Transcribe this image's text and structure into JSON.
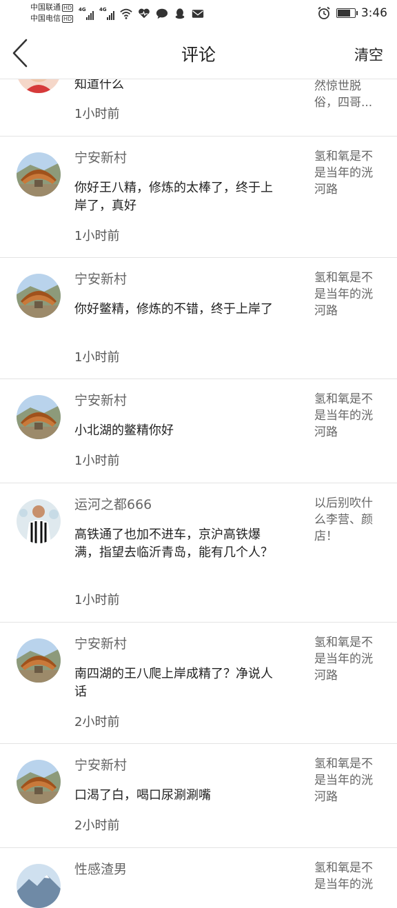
{
  "status_bar": {
    "carrier1": "中国联通",
    "carrier2": "中国电信",
    "hd": "HD",
    "net1": "4G",
    "net2": "4G",
    "time": "3:46"
  },
  "header": {
    "title": "评论",
    "clear_label": "清空"
  },
  "partial_item": {
    "content": "知道什么",
    "time": "1小时前",
    "quote": "然惊世脱俗，四哥..."
  },
  "comments": [
    {
      "name": "宁安新村",
      "content": "你好王八精，修炼的太棒了，终于上岸了，真好",
      "time": "1小时前",
      "quote": "氢和氧是不是当年的洸河路"
    },
    {
      "name": "宁安新村",
      "content": "你好鳖精，修炼的不错，终于上岸了",
      "time": "1小时前",
      "quote": "氢和氧是不是当年的洸河路"
    },
    {
      "name": "宁安新村",
      "content": "小北湖的鳖精你好",
      "time": "1小时前",
      "quote": "氢和氧是不是当年的洸河路"
    },
    {
      "name": "运河之都666",
      "content": "高铁通了也加不进车，京沪高铁爆满，指望去临沂青岛，能有几个人？",
      "time": "1小时前",
      "quote": "以后别吹什么李营、颜店！"
    },
    {
      "name": "宁安新村",
      "content": "南四湖的王八爬上岸成精了？净说人话",
      "time": "2小时前",
      "quote": "氢和氧是不是当年的洸河路"
    },
    {
      "name": "宁安新村",
      "content": "口渴了白，喝口尿涮涮嘴",
      "time": "2小时前",
      "quote": "氢和氧是不是当年的洸河路"
    }
  ],
  "last_item": {
    "name": "性感渣男",
    "quote": "氢和氧是不是当年的洸"
  }
}
